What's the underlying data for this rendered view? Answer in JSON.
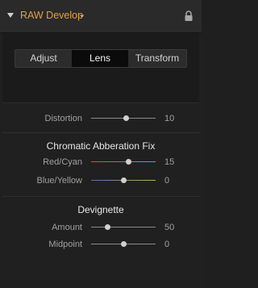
{
  "header": {
    "title": "RAW Develop",
    "chevron": "⌄",
    "lock_icon": "lock-icon"
  },
  "tabs": [
    {
      "label": "Adjust",
      "selected": false
    },
    {
      "label": "Lens",
      "selected": true
    },
    {
      "label": "Transform",
      "selected": false
    }
  ],
  "distortion": {
    "label": "Distortion",
    "value": "10"
  },
  "chromatic": {
    "title": "Chromatic Abberation Fix",
    "red_cyan": {
      "label": "Red/Cyan",
      "value": "15"
    },
    "blue_yellow": {
      "label": "Blue/Yellow",
      "value": "0"
    }
  },
  "devignette": {
    "title": "Devignette",
    "amount": {
      "label": "Amount",
      "value": "50"
    },
    "midpoint": {
      "label": "Midpoint",
      "value": "0"
    }
  },
  "colors": {
    "accent": "#e0a04a",
    "red_cyan_left": "#c0504a",
    "red_cyan_right": "#3fb0c0",
    "blue_yellow_left": "#4a6fc0",
    "blue_yellow_right": "#c0b040"
  }
}
